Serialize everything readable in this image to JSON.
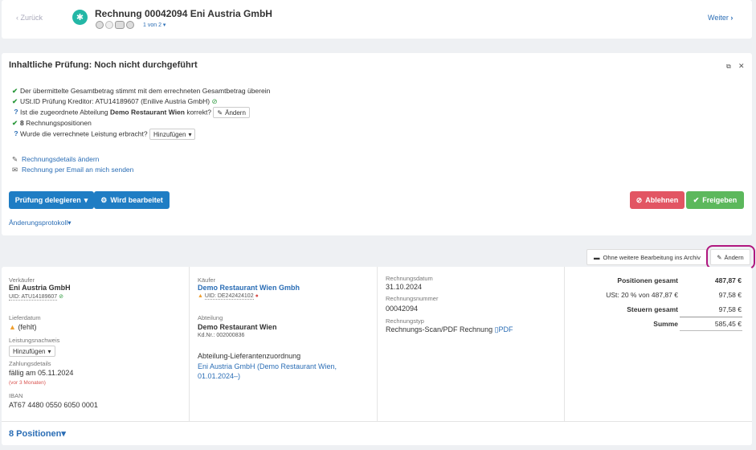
{
  "header": {
    "back_label": "Zurück",
    "title": "Rechnung 00042094 Eni Austria GmbH",
    "page_indicator": "1 von 2",
    "next_label": "Weiter"
  },
  "review": {
    "title": "Inhaltliche Prüfung: Noch nicht durchgeführt",
    "check1": "Der übermittelte Gesamtbetrag stimmt mit dem errechneten Gesamtbetrag überein",
    "check2_prefix": "USt.ID Prüfung Kreditor: ",
    "check2_vat": "ATU14189607 (Enilive Austria GmbH)",
    "question1_prefix": "Ist die zugeordnete Abteilung ",
    "question1_dept": "Demo Restaurant Wien",
    "question1_suffix": " korrekt?",
    "change_label": "Ändern",
    "check3_count": "8",
    "check3_text": " Rechnungspositionen",
    "question2": "Wurde die verrechnete Leistung erbracht?",
    "add_label": "Hinzufügen",
    "edit_details": "Rechnungsdetails ändern",
    "send_email": "Rechnung per Email an mich senden",
    "delegate_label": "Prüfung delegieren",
    "in_progress_label": "Wird bearbeitet",
    "reject_label": "Ablehnen",
    "approve_label": "Freigeben",
    "changelog_label": "Änderungsprotokoll"
  },
  "actions": {
    "archive_label": "Ohne weitere Bearbeitung ins Archiv",
    "edit_label": "Ändern"
  },
  "seller": {
    "label": "Verkäufer",
    "name": "Eni Austria GmbH",
    "uid": "UID: ATU14189607",
    "delivery_date_label": "Lieferdatum",
    "delivery_date_value": "(fehlt)",
    "proof_label": "Leistungsnachweis",
    "proof_button": "Hinzufügen",
    "payment_label": "Zahlungsdetails",
    "payment_due": "fällig am 05.11.2024",
    "payment_note": "(vor 3 Monaten)",
    "iban_label": "IBAN",
    "iban_value": "AT67 4480 0550 6050 0001"
  },
  "buyer": {
    "label": "Käufer",
    "name": "Demo Restaurant Wien Gmbh",
    "uid": "UID: DE242424102",
    "department_label": "Abteilung",
    "department_name": "Demo Restaurant Wien",
    "customer_no": "Kd.Nr.: 002000836",
    "assignment_label": "Abteilung-Lieferantenzuordnung",
    "assignment_line1": "Eni Austria GmbH (Demo Restaurant Wien,",
    "assignment_line2": "01.01.2024–)"
  },
  "invoice": {
    "date_label": "Rechnungsdatum",
    "date_value": "31.10.2024",
    "number_label": "Rechnungsnummer",
    "number_value": "00042094",
    "type_label": "Rechnungstyp",
    "type_value": "Rechnungs-Scan/PDF Rechnung",
    "pdf_label": "PDF"
  },
  "totals": {
    "positions_label": "Positionen gesamt",
    "positions_value": "487,87 €",
    "vat_label": "USt: 20 % von 487,87 €",
    "vat_value": "97,58 €",
    "taxes_label": "Steuern gesamt",
    "taxes_value": "97,58 €",
    "sum_label": "Summe",
    "sum_value": "585,45 €"
  },
  "positions_toggle": "8 Positionen",
  "colors": {
    "primary": "#1f7dc4",
    "danger": "#e25563",
    "success": "#5cb85c",
    "highlight": "#b0177f"
  }
}
